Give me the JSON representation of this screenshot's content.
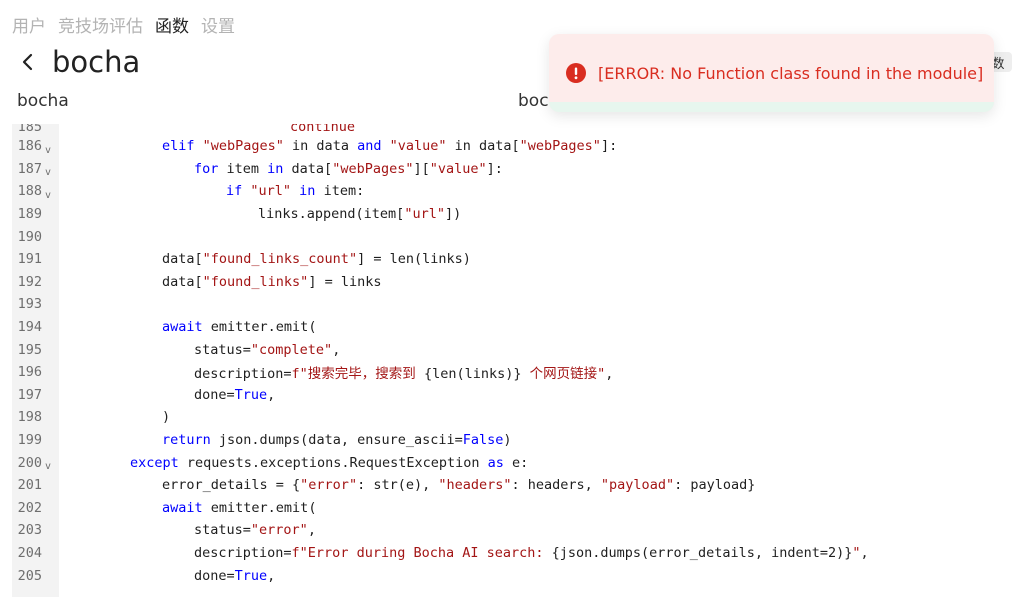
{
  "nav": {
    "items": [
      {
        "label": "用户",
        "active": false
      },
      {
        "label": "竞技场评估",
        "active": false
      },
      {
        "label": "函数",
        "active": true
      },
      {
        "label": "设置",
        "active": false
      }
    ]
  },
  "header": {
    "back_icon": "chevron-left-icon",
    "title": "bocha"
  },
  "form": {
    "name_value": "bocha",
    "id_value": "boch"
  },
  "right_tab": {
    "label": "数"
  },
  "toast": {
    "icon": "error-circle-icon",
    "message": "[ERROR: No Function class found in the module]",
    "color": "#d92d20"
  },
  "editor": {
    "top_fragment": "continue",
    "lines": [
      {
        "n": "186",
        "fold": true,
        "indent": 4,
        "tokens": [
          [
            "kw",
            "elif "
          ],
          [
            "str",
            "\"webPages\""
          ],
          [
            "t",
            " in data "
          ],
          [
            "kw",
            "and "
          ],
          [
            "str",
            "\"value\""
          ],
          [
            "t",
            " in data["
          ],
          [
            "str",
            "\"webPages\""
          ],
          [
            "t",
            "]:"
          ]
        ]
      },
      {
        "n": "187",
        "fold": true,
        "indent": 5,
        "tokens": [
          [
            "kw",
            "for "
          ],
          [
            "t",
            "item "
          ],
          [
            "kw",
            "in "
          ],
          [
            "t",
            "data["
          ],
          [
            "str",
            "\"webPages\""
          ],
          [
            "t",
            "]["
          ],
          [
            "str",
            "\"value\""
          ],
          [
            "t",
            "]:"
          ]
        ]
      },
      {
        "n": "188",
        "fold": true,
        "indent": 6,
        "tokens": [
          [
            "kw",
            "if "
          ],
          [
            "str",
            "\"url\""
          ],
          [
            "t",
            " "
          ],
          [
            "kw",
            "in "
          ],
          [
            "t",
            "item:"
          ]
        ]
      },
      {
        "n": "189",
        "fold": false,
        "indent": 7,
        "tokens": [
          [
            "t",
            "links.append(item["
          ],
          [
            "str",
            "\"url\""
          ],
          [
            "t",
            "])"
          ]
        ]
      },
      {
        "n": "190",
        "fold": false,
        "indent": 0,
        "tokens": []
      },
      {
        "n": "191",
        "fold": false,
        "indent": 4,
        "tokens": [
          [
            "t",
            "data["
          ],
          [
            "str",
            "\"found_links_count\""
          ],
          [
            "t",
            "] = len(links)"
          ]
        ]
      },
      {
        "n": "192",
        "fold": false,
        "indent": 4,
        "tokens": [
          [
            "t",
            "data["
          ],
          [
            "str",
            "\"found_links\""
          ],
          [
            "t",
            "] = links"
          ]
        ]
      },
      {
        "n": "193",
        "fold": false,
        "indent": 0,
        "tokens": []
      },
      {
        "n": "194",
        "fold": false,
        "indent": 4,
        "tokens": [
          [
            "kw",
            "await "
          ],
          [
            "t",
            "emitter.emit("
          ]
        ]
      },
      {
        "n": "195",
        "fold": false,
        "indent": 5,
        "tokens": [
          [
            "t",
            "status="
          ],
          [
            "str",
            "\"complete\""
          ],
          [
            "t",
            ","
          ]
        ]
      },
      {
        "n": "196",
        "fold": false,
        "indent": 5,
        "tokens": [
          [
            "t",
            "description="
          ],
          [
            "str",
            "f\"搜索完毕，搜索到 "
          ],
          [
            "t",
            "{len(links)}"
          ],
          [
            "str",
            " 个网页链接\""
          ],
          [
            "t",
            ","
          ]
        ]
      },
      {
        "n": "197",
        "fold": false,
        "indent": 5,
        "tokens": [
          [
            "t",
            "done="
          ],
          [
            "bl",
            "True"
          ],
          [
            "t",
            ","
          ]
        ]
      },
      {
        "n": "198",
        "fold": false,
        "indent": 4,
        "tokens": [
          [
            "t",
            ")"
          ]
        ]
      },
      {
        "n": "199",
        "fold": false,
        "indent": 4,
        "tokens": [
          [
            "kw",
            "return "
          ],
          [
            "t",
            "json.dumps(data, ensure_ascii="
          ],
          [
            "bl",
            "False"
          ],
          [
            "t",
            ")"
          ]
        ]
      },
      {
        "n": "200",
        "fold": true,
        "indent": 3,
        "tokens": [
          [
            "kw",
            "except "
          ],
          [
            "t",
            "requests.exceptions.RequestException "
          ],
          [
            "kw",
            "as "
          ],
          [
            "t",
            "e:"
          ]
        ]
      },
      {
        "n": "201",
        "fold": false,
        "indent": 4,
        "tokens": [
          [
            "t",
            "error_details = {"
          ],
          [
            "str",
            "\"error\""
          ],
          [
            "t",
            ": str(e), "
          ],
          [
            "str",
            "\"headers\""
          ],
          [
            "t",
            ": headers, "
          ],
          [
            "str",
            "\"payload\""
          ],
          [
            "t",
            ": payload}"
          ]
        ]
      },
      {
        "n": "202",
        "fold": false,
        "indent": 4,
        "tokens": [
          [
            "kw",
            "await "
          ],
          [
            "t",
            "emitter.emit("
          ]
        ]
      },
      {
        "n": "203",
        "fold": false,
        "indent": 5,
        "tokens": [
          [
            "t",
            "status="
          ],
          [
            "str",
            "\"error\""
          ],
          [
            "t",
            ","
          ]
        ]
      },
      {
        "n": "204",
        "fold": false,
        "indent": 5,
        "tokens": [
          [
            "t",
            "description="
          ],
          [
            "str",
            "f\"Error during Bocha AI search: "
          ],
          [
            "t",
            "{json.dumps(error_details, indent=2)}"
          ],
          [
            "str",
            "\""
          ],
          [
            "t",
            ","
          ]
        ]
      },
      {
        "n": "205",
        "fold": false,
        "indent": 5,
        "tokens": [
          [
            "t",
            "done="
          ],
          [
            "bl",
            "True"
          ],
          [
            "t",
            ","
          ]
        ]
      }
    ]
  }
}
